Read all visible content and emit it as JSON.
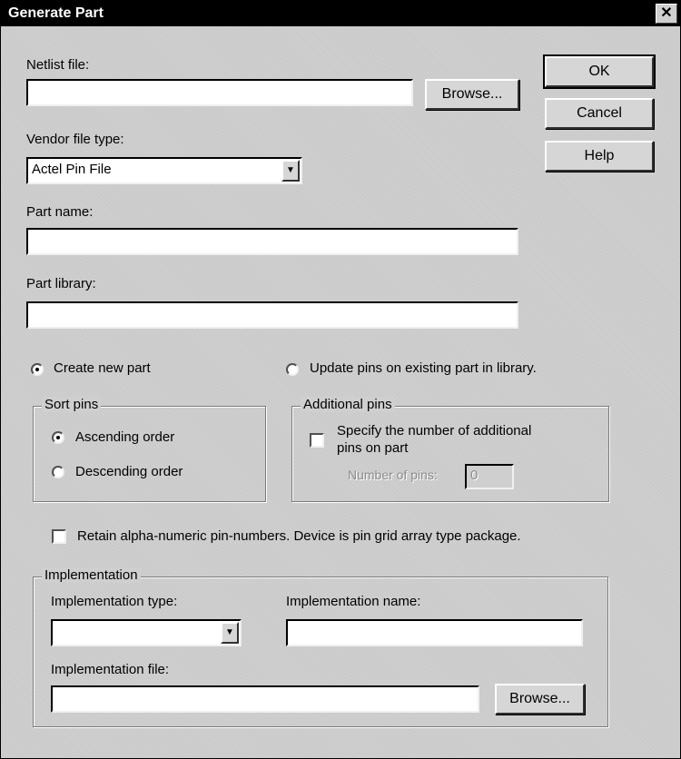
{
  "window": {
    "title": "Generate Part",
    "close_glyph": "✕"
  },
  "buttons": {
    "ok": "OK",
    "cancel": "Cancel",
    "help": "Help",
    "browse_netlist": "Browse...",
    "browse_impl": "Browse..."
  },
  "netlist": {
    "label": "Netlist file:",
    "value": ""
  },
  "vendor": {
    "label": "Vendor file type:",
    "value": "Actel Pin File"
  },
  "part_name": {
    "label": "Part name:",
    "value": ""
  },
  "part_library": {
    "label": "Part library:",
    "value": ""
  },
  "mode": {
    "create_label": "Create new part",
    "update_label": "Update pins on existing part in library.",
    "selected": "create"
  },
  "sort_pins": {
    "title": "Sort pins",
    "ascending": "Ascending order",
    "descending": "Descending order",
    "selected": "ascending"
  },
  "additional_pins": {
    "title": "Additional pins",
    "specify_line1": "Specify the number of additional",
    "specify_line2": "pins on part",
    "number_label": "Number of pins:",
    "number_value": "0",
    "checked": false
  },
  "retain": {
    "label": "Retain alpha-numeric pin-numbers. Device is pin grid array type package.",
    "checked": false
  },
  "implementation": {
    "title": "Implementation",
    "type_label": "Implementation type:",
    "type_value": "",
    "name_label": "Implementation name:",
    "name_value": "",
    "file_label": "Implementation file:",
    "file_value": ""
  },
  "icons": {
    "dropdown": "▼"
  }
}
